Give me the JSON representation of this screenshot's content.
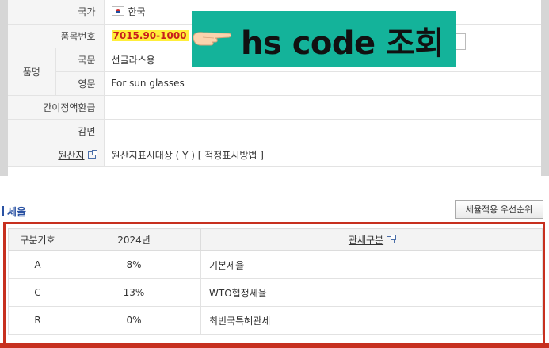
{
  "info": {
    "country_label": "국가",
    "country_value": "한국",
    "hs_label": "품목번호",
    "hs_value": "7015.90-1000",
    "name_label": "품명",
    "korean_label": "국문",
    "korean_value": "선글라스용",
    "english_label": "영문",
    "english_value": "For sun glasses",
    "refund_label": "간이정액환급",
    "refund_value": "",
    "reduction_label": "감면",
    "reduction_value": "",
    "origin_label": "원산지",
    "origin_value": "원산지표시대상 ( Y ) [ 적정표시방법 ]"
  },
  "banner": {
    "text": "hs code 조회",
    "color": "#14b39a",
    "icon": "pointing-hand-icon"
  },
  "tariff": {
    "title": "세율",
    "priority_button": "세율적용 우선순위",
    "headers": {
      "code": "구분기호",
      "year": "2024년",
      "type": "관세구분"
    },
    "rows": [
      {
        "code": "A",
        "rate": "8%",
        "type": "기본세율"
      },
      {
        "code": "C",
        "rate": "13%",
        "type": "WTO협정세율"
      },
      {
        "code": "R",
        "rate": "0%",
        "type": "최빈국특혜관세"
      }
    ]
  },
  "colors": {
    "highlight_border": "#c7301f",
    "hs_highlight": "#ffee3a",
    "hs_text": "#c81d1d",
    "title_blue": "#2a52a3"
  }
}
